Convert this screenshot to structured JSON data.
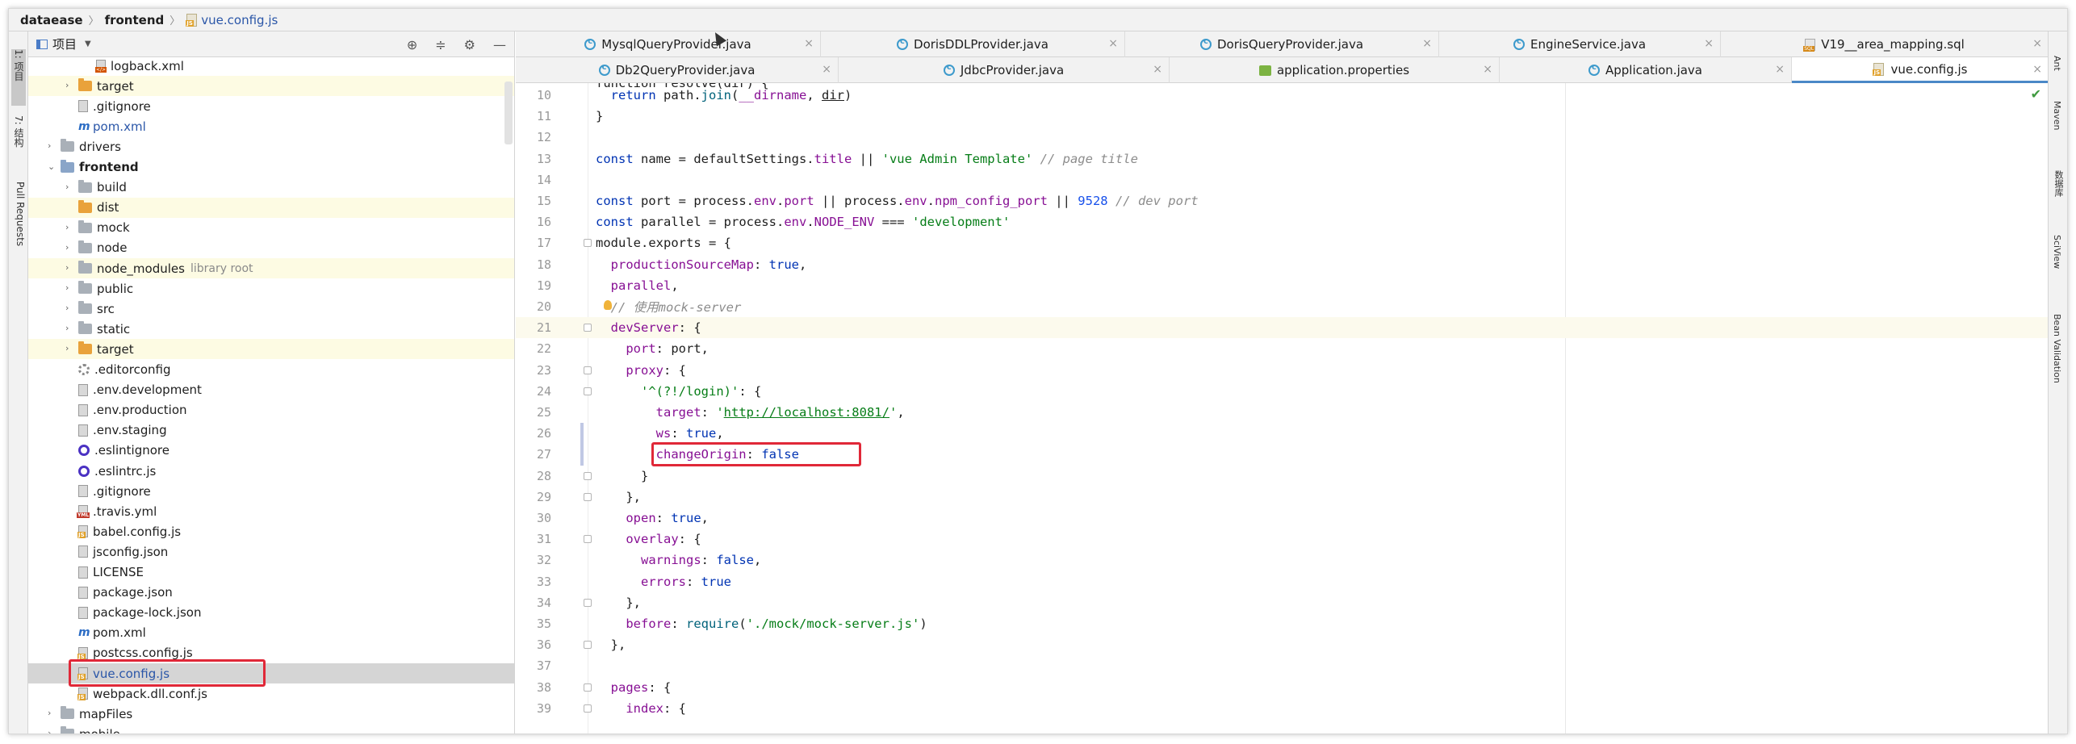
{
  "breadcrumb": {
    "root": "dataease",
    "folder": "frontend",
    "file": "vue.config.js"
  },
  "left_stripe": {
    "project": "1: 项目",
    "structure": "7: 结构",
    "pull_requests": "Pull Requests"
  },
  "right_stripe": {
    "ant": "Ant",
    "maven": "Maven",
    "database": "数据库",
    "sciview": "SciView",
    "bean_validation": "Bean Validation"
  },
  "project_panel": {
    "title": "项目",
    "tools": {
      "locate": "⊕",
      "collapse": "≑",
      "settings": "⚙",
      "hide": "—"
    },
    "tree": [
      {
        "label": "logback.xml",
        "icon": "xml",
        "indent": 3,
        "arrow": ""
      },
      {
        "label": "target",
        "icon": "folder-orange",
        "indent": 2,
        "arrow": "›",
        "hl": true
      },
      {
        "label": ".gitignore",
        "icon": "file",
        "indent": 2,
        "arrow": ""
      },
      {
        "label": "pom.xml",
        "icon": "maven",
        "indent": 2,
        "arrow": "",
        "blue": true
      },
      {
        "label": "drivers",
        "icon": "folder",
        "indent": 1,
        "arrow": "›"
      },
      {
        "label": "frontend",
        "icon": "folder-blue",
        "indent": 1,
        "arrow": "⌄",
        "bold": true
      },
      {
        "label": "build",
        "icon": "folder",
        "indent": 2,
        "arrow": "›"
      },
      {
        "label": "dist",
        "icon": "folder-orange",
        "indent": 2,
        "arrow": "",
        "hl": true
      },
      {
        "label": "mock",
        "icon": "folder",
        "indent": 2,
        "arrow": "›"
      },
      {
        "label": "node",
        "icon": "folder",
        "indent": 2,
        "arrow": "›"
      },
      {
        "label": "node_modules",
        "icon": "folder",
        "indent": 2,
        "arrow": "›",
        "lib": "library root",
        "hl": true
      },
      {
        "label": "public",
        "icon": "folder",
        "indent": 2,
        "arrow": "›"
      },
      {
        "label": "src",
        "icon": "folder",
        "indent": 2,
        "arrow": "›"
      },
      {
        "label": "static",
        "icon": "folder",
        "indent": 2,
        "arrow": "›"
      },
      {
        "label": "target",
        "icon": "folder-orange",
        "indent": 2,
        "arrow": "›",
        "hl": true
      },
      {
        "label": ".editorconfig",
        "icon": "gear",
        "indent": 2,
        "arrow": ""
      },
      {
        "label": ".env.development",
        "icon": "file",
        "indent": 2,
        "arrow": ""
      },
      {
        "label": ".env.production",
        "icon": "file",
        "indent": 2,
        "arrow": ""
      },
      {
        "label": ".env.staging",
        "icon": "file",
        "indent": 2,
        "arrow": ""
      },
      {
        "label": ".eslintignore",
        "icon": "eslint",
        "indent": 2,
        "arrow": ""
      },
      {
        "label": ".eslintrc.js",
        "icon": "eslint",
        "indent": 2,
        "arrow": ""
      },
      {
        "label": ".gitignore",
        "icon": "file",
        "indent": 2,
        "arrow": ""
      },
      {
        "label": ".travis.yml",
        "icon": "yml",
        "indent": 2,
        "arrow": ""
      },
      {
        "label": "babel.config.js",
        "icon": "js",
        "indent": 2,
        "arrow": ""
      },
      {
        "label": "jsconfig.json",
        "icon": "file",
        "indent": 2,
        "arrow": ""
      },
      {
        "label": "LICENSE",
        "icon": "file",
        "indent": 2,
        "arrow": ""
      },
      {
        "label": "package.json",
        "icon": "file",
        "indent": 2,
        "arrow": ""
      },
      {
        "label": "package-lock.json",
        "icon": "file",
        "indent": 2,
        "arrow": ""
      },
      {
        "label": "pom.xml",
        "icon": "maven",
        "indent": 2,
        "arrow": ""
      },
      {
        "label": "postcss.config.js",
        "icon": "js",
        "indent": 2,
        "arrow": ""
      },
      {
        "label": "vue.config.js",
        "icon": "js",
        "indent": 2,
        "arrow": "",
        "selected": true,
        "blue": true
      },
      {
        "label": "webpack.dll.conf.js",
        "icon": "js",
        "indent": 2,
        "arrow": ""
      },
      {
        "label": "mapFiles",
        "icon": "folder",
        "indent": 1,
        "arrow": "›"
      },
      {
        "label": "mobile",
        "icon": "folder",
        "indent": 1,
        "arrow": "›"
      }
    ]
  },
  "editor_tabs_row1": [
    {
      "label": "MysqlQueryProvider.java",
      "icon": "class"
    },
    {
      "label": "DorisDDLProvider.java",
      "icon": "class"
    },
    {
      "label": "DorisQueryProvider.java",
      "icon": "class"
    },
    {
      "label": "EngineService.java",
      "icon": "class"
    },
    {
      "label": "V19__area_mapping.sql",
      "icon": "sql"
    }
  ],
  "editor_tabs_row2": [
    {
      "label": "Db2QueryProvider.java",
      "icon": "class"
    },
    {
      "label": "JdbcProvider.java",
      "icon": "class"
    },
    {
      "label": "application.properties",
      "icon": "properties"
    },
    {
      "label": "Application.java",
      "icon": "class"
    },
    {
      "label": "vue.config.js",
      "icon": "js",
      "active": true
    }
  ],
  "tab_close": "×",
  "check_mark": "✔",
  "code_lines": [
    {
      "n": "10",
      "parts": [
        [
          "",
          "  "
        ],
        [
          "kw",
          "return "
        ],
        [
          "",
          "path."
        ],
        [
          "fn",
          "join"
        ],
        [
          "",
          "("
        ],
        [
          "prop",
          "__dirname"
        ],
        [
          "",
          ", "
        ],
        [
          "ul",
          "dir"
        ],
        [
          "",
          ")"
        ]
      ]
    },
    {
      "n": "11",
      "parts": [
        [
          "",
          "}"
        ]
      ]
    },
    {
      "n": "12",
      "parts": []
    },
    {
      "n": "13",
      "parts": [
        [
          "kw",
          "const "
        ],
        [
          "",
          "name = defaultSettings."
        ],
        [
          "prop",
          "title"
        ],
        [
          "",
          " || "
        ],
        [
          "str",
          "'vue Admin Template'"
        ],
        [
          "cm",
          " // page title"
        ]
      ]
    },
    {
      "n": "14",
      "parts": []
    },
    {
      "n": "15",
      "parts": [
        [
          "kw",
          "const "
        ],
        [
          "",
          "port = process."
        ],
        [
          "prop",
          "env"
        ],
        [
          "",
          "."
        ],
        [
          "prop",
          "port"
        ],
        [
          "",
          " || process."
        ],
        [
          "prop",
          "env"
        ],
        [
          "",
          "."
        ],
        [
          "prop",
          "npm_config_port"
        ],
        [
          "",
          " || "
        ],
        [
          "num",
          "9528"
        ],
        [
          "cm",
          " // dev port"
        ]
      ]
    },
    {
      "n": "16",
      "parts": [
        [
          "kw",
          "const "
        ],
        [
          "",
          "parallel = process."
        ],
        [
          "prop",
          "env"
        ],
        [
          "",
          "."
        ],
        [
          "prop",
          "NODE_ENV"
        ],
        [
          "",
          " === "
        ],
        [
          "str",
          "'development'"
        ]
      ]
    },
    {
      "n": "17",
      "parts": [
        [
          "",
          "module.exports = {"
        ]
      ]
    },
    {
      "n": "18",
      "parts": [
        [
          "",
          "  "
        ],
        [
          "prop",
          "productionSourceMap"
        ],
        [
          "",
          ": "
        ],
        [
          "kw",
          "true"
        ],
        [
          "",
          ","
        ]
      ]
    },
    {
      "n": "19",
      "parts": [
        [
          "",
          "  "
        ],
        [
          "prop",
          "parallel"
        ],
        [
          "",
          ","
        ]
      ]
    },
    {
      "n": "20",
      "parts": [
        [
          "",
          "  "
        ],
        [
          "cm",
          "// 使用mock-server"
        ]
      ]
    },
    {
      "n": "21",
      "parts": [
        [
          "",
          "  "
        ],
        [
          "prop",
          "devServer"
        ],
        [
          "",
          ": {"
        ]
      ]
    },
    {
      "n": "22",
      "parts": [
        [
          "",
          "    "
        ],
        [
          "prop",
          "port"
        ],
        [
          "",
          ": port,"
        ]
      ]
    },
    {
      "n": "23",
      "parts": [
        [
          "",
          "    "
        ],
        [
          "prop",
          "proxy"
        ],
        [
          "",
          ": {"
        ]
      ]
    },
    {
      "n": "24",
      "parts": [
        [
          "",
          "      "
        ],
        [
          "str",
          "'^(?!/login)'"
        ],
        [
          "",
          ": {"
        ]
      ]
    },
    {
      "n": "25",
      "parts": [
        [
          "",
          "        "
        ],
        [
          "prop",
          "target"
        ],
        [
          "",
          ": "
        ],
        [
          "str",
          "'"
        ],
        [
          "link",
          "http://localhost:8081/"
        ],
        [
          "str",
          "'"
        ],
        [
          "",
          ","
        ]
      ]
    },
    {
      "n": "26",
      "parts": [
        [
          "",
          "        "
        ],
        [
          "prop",
          "ws"
        ],
        [
          "",
          ": "
        ],
        [
          "kw",
          "true"
        ],
        [
          "",
          ","
        ]
      ]
    },
    {
      "n": "27",
      "parts": [
        [
          "",
          "        "
        ],
        [
          "prop",
          "changeOrigin"
        ],
        [
          "",
          ": "
        ],
        [
          "kw",
          "false"
        ]
      ]
    },
    {
      "n": "28",
      "parts": [
        [
          "",
          "      }"
        ]
      ]
    },
    {
      "n": "29",
      "parts": [
        [
          "",
          "    },"
        ]
      ]
    },
    {
      "n": "30",
      "parts": [
        [
          "",
          "    "
        ],
        [
          "prop",
          "open"
        ],
        [
          "",
          ": "
        ],
        [
          "kw",
          "true"
        ],
        [
          "",
          ","
        ]
      ]
    },
    {
      "n": "31",
      "parts": [
        [
          "",
          "    "
        ],
        [
          "prop",
          "overlay"
        ],
        [
          "",
          ": {"
        ]
      ]
    },
    {
      "n": "32",
      "parts": [
        [
          "",
          "      "
        ],
        [
          "prop",
          "warnings"
        ],
        [
          "",
          ": "
        ],
        [
          "kw",
          "false"
        ],
        [
          "",
          ","
        ]
      ]
    },
    {
      "n": "33",
      "parts": [
        [
          "",
          "      "
        ],
        [
          "prop",
          "errors"
        ],
        [
          "",
          ": "
        ],
        [
          "kw",
          "true"
        ]
      ]
    },
    {
      "n": "34",
      "parts": [
        [
          "",
          "    },"
        ]
      ]
    },
    {
      "n": "35",
      "parts": [
        [
          "",
          "    "
        ],
        [
          "prop",
          "before"
        ],
        [
          "",
          ": "
        ],
        [
          "fn",
          "require"
        ],
        [
          "",
          "("
        ],
        [
          "str",
          "'./mock/mock-server.js'"
        ],
        [
          "",
          ")"
        ]
      ]
    },
    {
      "n": "36",
      "parts": [
        [
          "",
          "  },"
        ]
      ]
    },
    {
      "n": "37",
      "parts": []
    },
    {
      "n": "38",
      "parts": [
        [
          "",
          "  "
        ],
        [
          "prop",
          "pages"
        ],
        [
          "",
          ": {"
        ]
      ]
    },
    {
      "n": "39",
      "parts": [
        [
          "",
          "    "
        ],
        [
          "prop",
          "index"
        ],
        [
          "",
          ": {"
        ]
      ]
    }
  ],
  "partial_top_line": "function resolve(dir) {"
}
